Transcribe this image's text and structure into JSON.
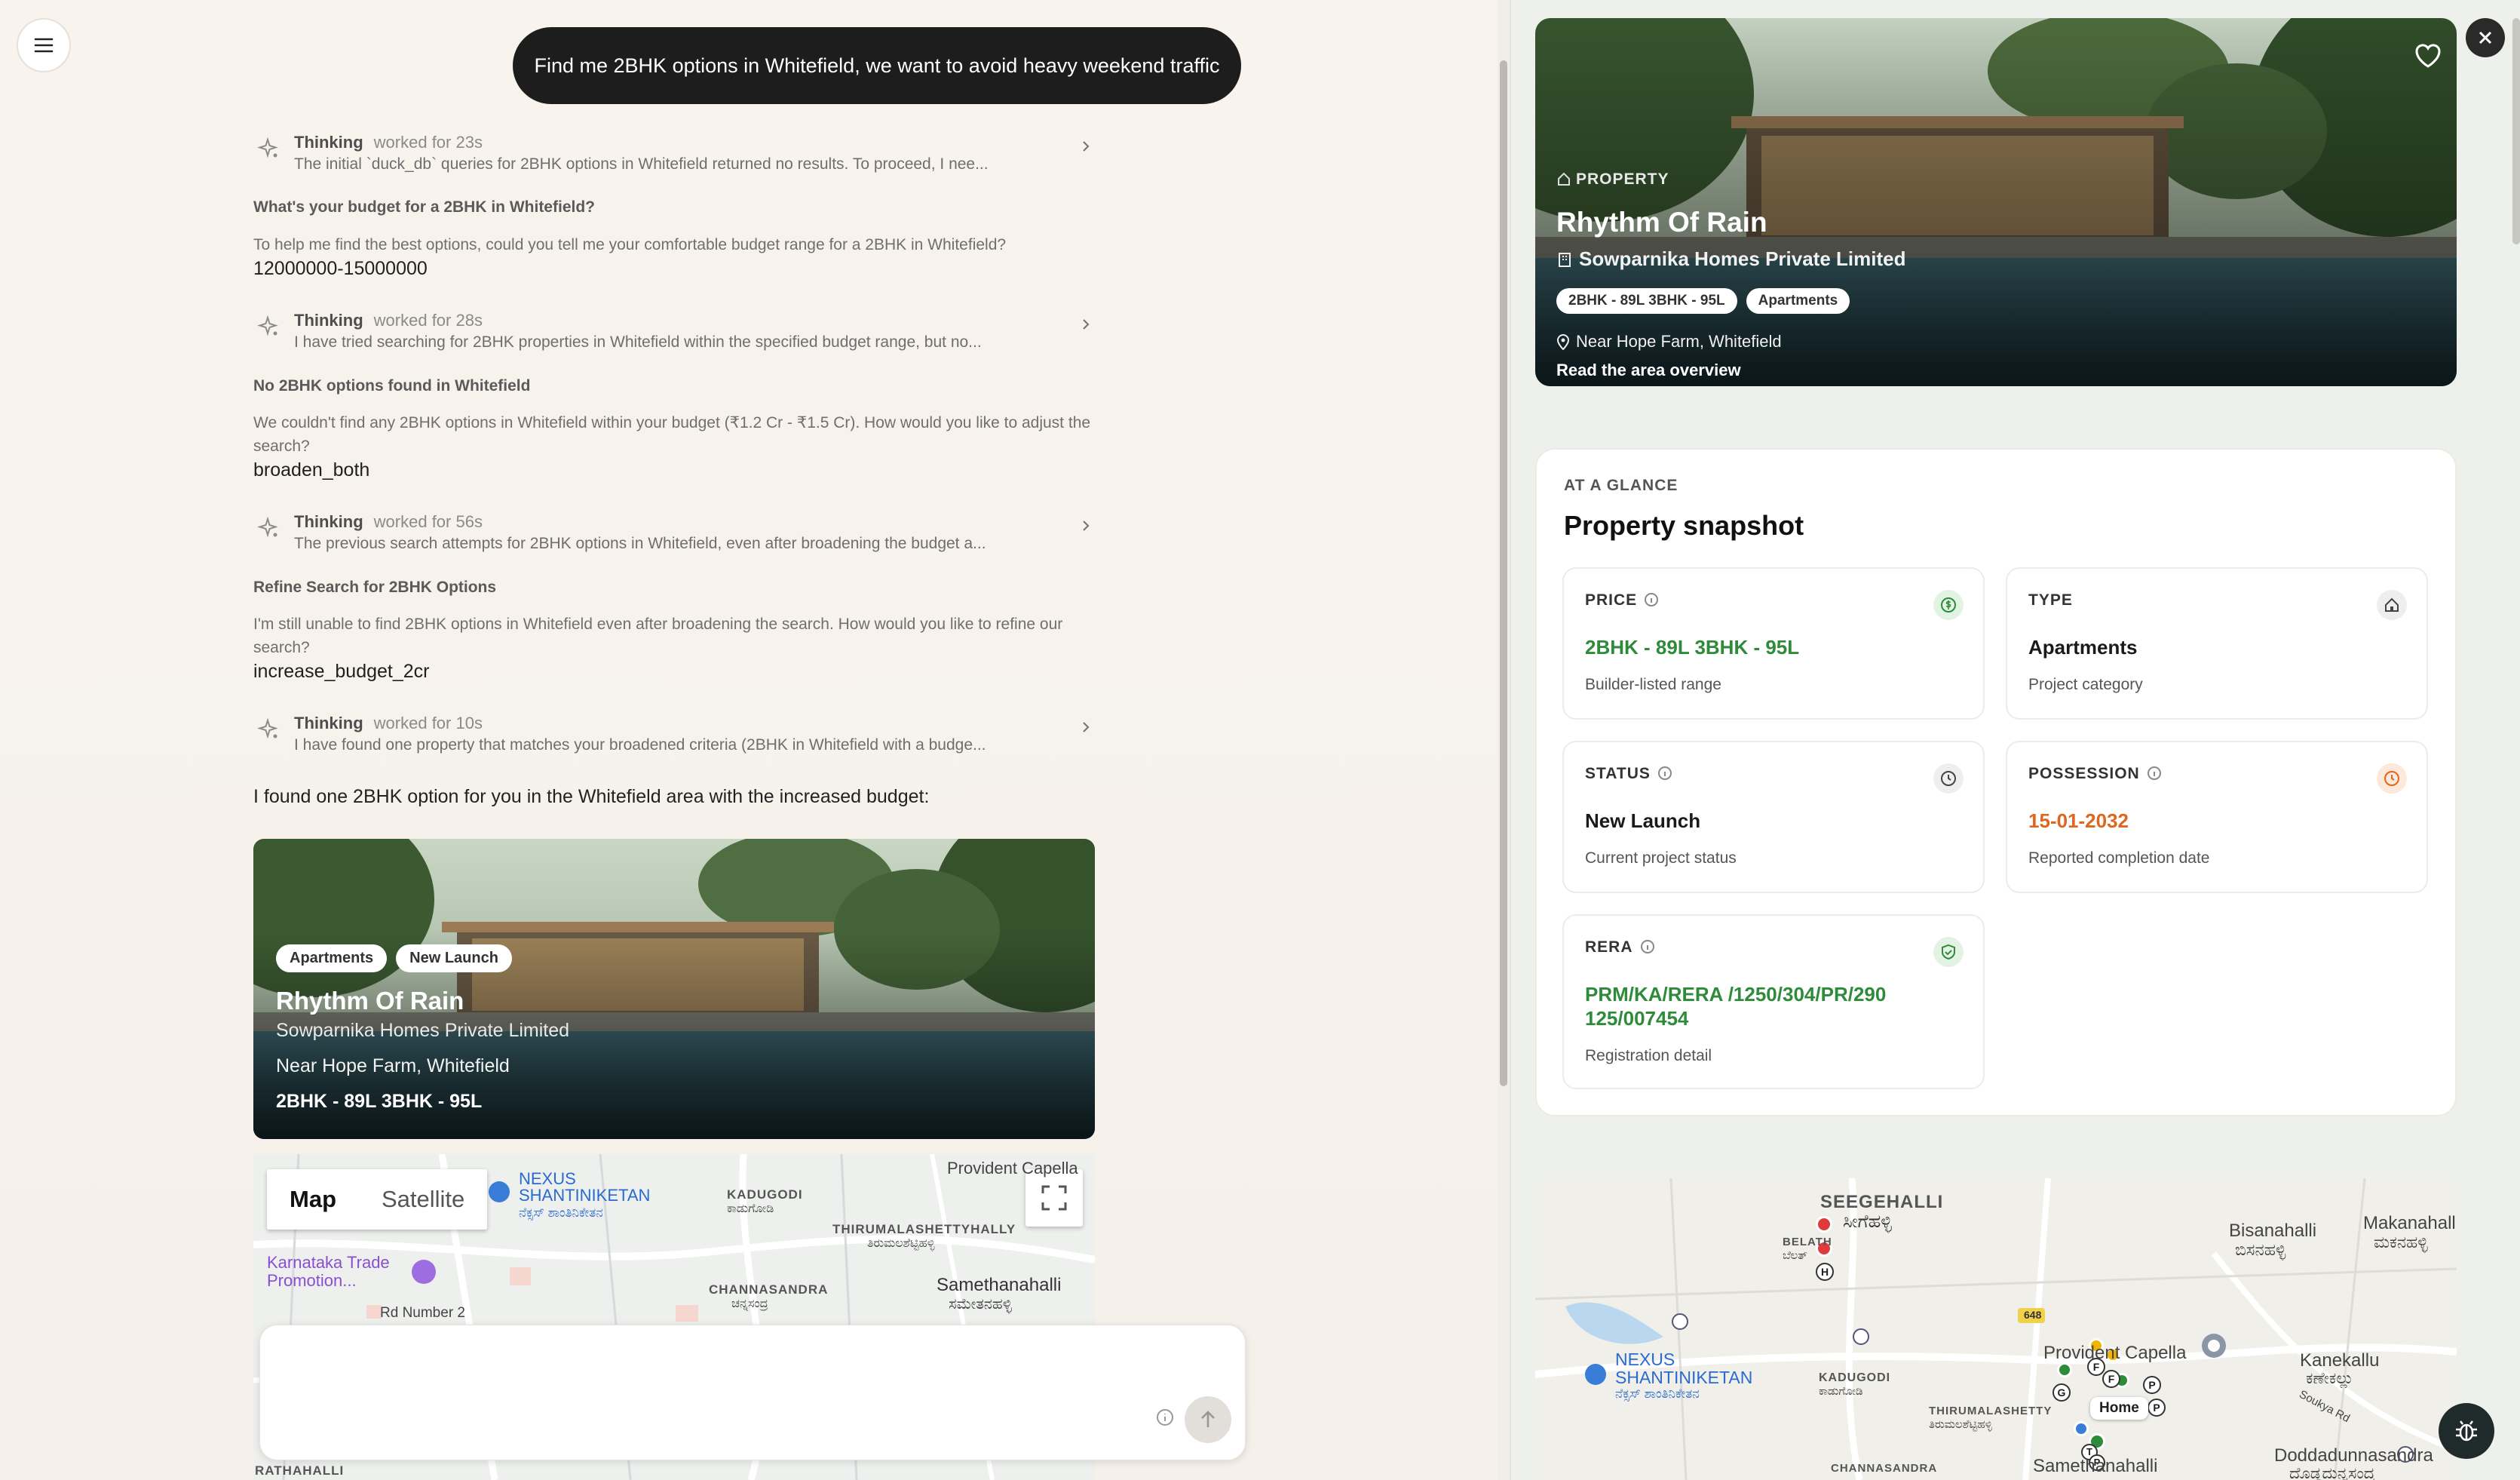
{
  "user_message": "Find me 2BHK options in Whitefield, we want to avoid heavy weekend traffic",
  "thinking": [
    {
      "title": "Thinking",
      "time": "worked for 23s",
      "text": "The initial `duck_db` queries for 2BHK options in Whitefield returned no results. To proceed, I nee..."
    },
    {
      "title": "Thinking",
      "time": "worked for 28s",
      "text": "I have tried searching for 2BHK properties in Whitefield within the specified budget range, but no..."
    },
    {
      "title": "Thinking",
      "time": "worked for 56s",
      "text": "The previous search attempts for 2BHK options in Whitefield, even after broadening the budget a..."
    },
    {
      "title": "Thinking",
      "time": "worked for 10s",
      "text": "I have found one property that matches your broadened criteria (2BHK in Whitefield with a budge..."
    }
  ],
  "questions": [
    {
      "title": "What's your budget for a 2BHK in Whitefield?",
      "text": "To help me find the best options, could you tell me your comfortable budget range for a 2BHK in Whitefield?",
      "answer": "12000000-15000000"
    },
    {
      "title": "No 2BHK options found in Whitefield",
      "text": "We couldn't find any 2BHK options in Whitefield within your budget (₹1.2 Cr - ₹1.5 Cr). How would you like to adjust the search?",
      "answer": "broaden_both"
    },
    {
      "title": "Refine Search for 2BHK Options",
      "text": "I'm still unable to find 2BHK options in Whitefield even after broadening the search. How would you like to refine our search?",
      "answer": "increase_budget_2cr"
    }
  ],
  "found_text": "I found one 2BHK option for you in the Whitefield area with the increased budget:",
  "chat_card": {
    "badges": [
      "Apartments",
      "New Launch"
    ],
    "name": "Rhythm Of Rain",
    "developer": "Sowparnika Homes Private Limited",
    "location": "Near Hope Farm, Whitefield",
    "price": "2BHK - 89L 3BHK - 95L"
  },
  "chat_map": {
    "toggle": [
      "Map",
      "Satellite"
    ],
    "labels": {
      "nexus": "NEXUS\nSHANTINIKETAN",
      "nexus_kn": "ನೆಕ್ಸಸ್ ಶಾಂತಿನಿಕೇತನ",
      "kadugodi": "KADUGODI",
      "kadugodi_kn": "ಕಾಡುಗೋಡಿ",
      "provident": "Provident Capella",
      "thirumalashettyhally": "THIRUMALASHETTYHALLY",
      "thirumala_kn": "ತಿರುಮಲಶೆಟ್ಟಿಹಳ್ಳಿ",
      "karnataka_trade": "Karnataka Trade\nPromotion...",
      "channasandra": "CHANNASANDRA",
      "channasandra_kn": "ಚನ್ನಸಂದ್ರ",
      "samethanahalli": "Samethanahalli",
      "samethanahalli_kn": "ಸಮೇತನಹಳ್ಳಿ",
      "rd_number": "Rd Number 2",
      "rathahalli": "RATHAHALLI"
    }
  },
  "composer": {
    "placeholder": ""
  },
  "panel": {
    "hero": {
      "kicker": "PROPERTY",
      "name": "Rhythm Of Rain",
      "developer": "Sowparnika Homes Private Limited",
      "tags": [
        "2BHK - 89L 3BHK - 95L",
        "Apartments"
      ],
      "location": "Near Hope Farm, Whitefield",
      "link": "Read the area overview"
    },
    "snapshot": {
      "kicker": "AT A GLANCE",
      "title": "Property snapshot",
      "stats": [
        {
          "label": "PRICE",
          "value": "2BHK - 89L 3BHK - 95L",
          "sub": "Builder-listed range",
          "color": "#2e8b3a",
          "icon": "dollar-icon",
          "icon_bg": "#e3f3e3"
        },
        {
          "label": "TYPE",
          "value": "Apartments",
          "sub": "Project category",
          "color": "#1a1a1a",
          "icon": "home-icon",
          "icon_bg": "#eeeeee"
        },
        {
          "label": "STATUS",
          "value": "New Launch",
          "sub": "Current project status",
          "color": "#1a1a1a",
          "icon": "clock-icon",
          "icon_bg": "#eeeeee"
        },
        {
          "label": "POSSESSION",
          "value": "15-01-2032",
          "sub": "Reported completion date",
          "color": "#e0661e",
          "icon": "clock-icon",
          "icon_bg": "#fde8da"
        },
        {
          "label": "RERA",
          "value": "PRM/KA/RERA /1250/304/PR/290\n125/007454",
          "sub": "Registration detail",
          "color": "#2e8b3a",
          "icon": "shield-check-icon",
          "icon_bg": "#e3f3e3"
        }
      ]
    },
    "map": {
      "labels": {
        "seegehalli": "SEEGEHALLI",
        "seegehalli_kn": "ಸೀಗೆಹಳ್ಳಿ",
        "belath": "BELATH",
        "belath_kn": "ಬೆಲತ್",
        "bisanahalli": "Bisanahalli",
        "bisanahalli_kn": "ಬಿಸನಹಳ್ಳಿ",
        "makanahalli": "Makanahalli",
        "makanahalli_kn": "ಮಕನಹಳ್ಳಿ",
        "nexus": "NEXUS\nSHANTINIKETAN",
        "nexus_kn": "ನೆಕ್ಸಸ್ ಶಾಂತಿನಿಕೇತನ",
        "kadugodi": "KADUGODI",
        "kadugodi_kn": "ಕಾಡುಗೋಡಿ",
        "provident": "Provident Capella",
        "kanekallu": "Kanekallu",
        "kanekallu_kn": "ಕಣೇಕಲ್ಲು",
        "thirumala": "THIRUMALASHETTY",
        "thirumala_kn": "ತಿರುಮಲಶೆಟ್ಟಿಹಳ್ಳಿ",
        "channasandra": "CHANNASANDRA",
        "samethanahalli": "Samethanahalli",
        "doddadunnasandra": "Doddadunnasandra",
        "doddadunnasandra_kn": "ದೊಡ್ಡದುನ್ನಸಂದ್ರ",
        "soukya": "Soukya Rd",
        "road_648": "648",
        "home": "Home",
        "pin_h": "H",
        "pin_g": "G",
        "pin_f1": "F",
        "pin_f2": "F",
        "pin_p1": "P",
        "pin_p2": "P",
        "pin_t": "T"
      }
    }
  }
}
